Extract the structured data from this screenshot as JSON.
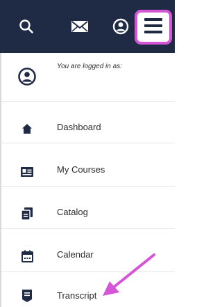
{
  "topbar": {
    "icons": [
      "search-icon",
      "mail-icon",
      "user-circle-icon"
    ],
    "menu_icon": "hamburger-icon",
    "highlight_color": "#d455d6",
    "bg_color": "#1f2a44"
  },
  "menu": {
    "logged_in_text": "You are logged in as:",
    "items": [
      {
        "label": "Dashboard",
        "icon": "home-icon"
      },
      {
        "label": "My Courses",
        "icon": "id-card-icon"
      },
      {
        "label": "Catalog",
        "icon": "copy-icon"
      },
      {
        "label": "Calendar",
        "icon": "calendar-icon"
      },
      {
        "label": "Transcript",
        "icon": "transcript-icon"
      }
    ]
  },
  "annotation": {
    "arrow_color": "#d455d6",
    "points_to": "Transcript"
  }
}
